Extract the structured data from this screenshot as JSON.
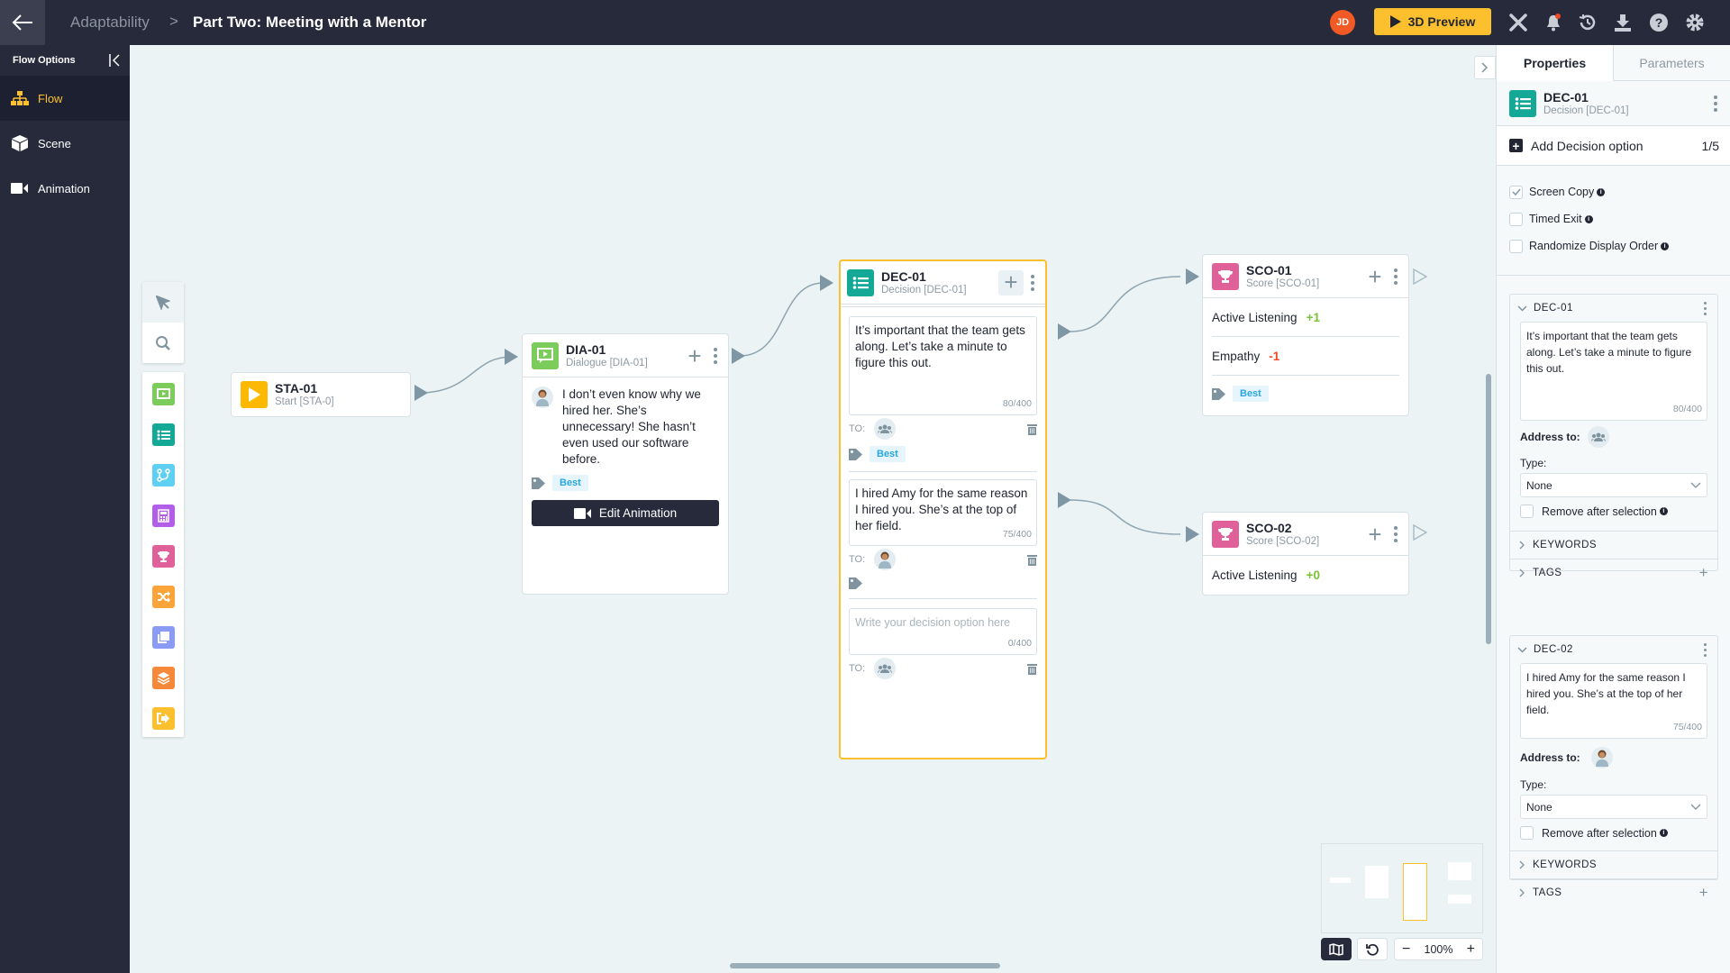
{
  "header": {
    "breadcrumb_parent": "Adaptability",
    "breadcrumb_separator": ">",
    "title": "Part Two: Meeting with a Mentor",
    "user_initials": "JD",
    "preview_label": "3D Preview",
    "icons": [
      "back-arrow-icon",
      "tools-icon",
      "bell-icon",
      "history-icon",
      "download-icon",
      "help-icon",
      "gear-icon"
    ]
  },
  "sidebar": {
    "title": "Flow Options",
    "items": [
      {
        "label": "Flow",
        "icon": "sitemap-icon",
        "active": true
      },
      {
        "label": "Scene",
        "icon": "cube-icon",
        "active": false
      },
      {
        "label": "Animation",
        "icon": "video-camera-icon",
        "active": false
      }
    ]
  },
  "toolbox": {
    "tools": [
      "pointer-icon",
      "search-icon"
    ],
    "node_types": [
      {
        "name": "dialogue",
        "color": "#7ccc5b"
      },
      {
        "name": "decision",
        "color": "#14a896"
      },
      {
        "name": "branch",
        "color": "#5fd0f2"
      },
      {
        "name": "calculator",
        "color": "#b15fe8"
      },
      {
        "name": "score",
        "color": "#e0609a"
      },
      {
        "name": "random",
        "color": "#fba43a"
      },
      {
        "name": "copy",
        "color": "#8a9bf5"
      },
      {
        "name": "layers",
        "color": "#f6883a"
      },
      {
        "name": "exit",
        "color": "#fcc02e"
      }
    ]
  },
  "nodes": {
    "start": {
      "title": "STA-01",
      "subtitle": "Start [STA-0]"
    },
    "dialogue": {
      "title": "DIA-01",
      "subtitle": "Dialogue [DIA-01]",
      "text": "I don’t even know why we hired her. She’s unnecessary! She hasn’t even used our software before.",
      "tag": "Best",
      "button": "Edit Animation"
    },
    "decision": {
      "title": "DEC-01",
      "subtitle": "Decision [DEC-01]",
      "to_label": "TO:",
      "options": [
        {
          "text": "It’s important that the team gets along. Let’s take a minute to figure this out.",
          "count": "80/400",
          "tag": "Best",
          "to": "group"
        },
        {
          "text": "I hired Amy for the same reason I hired you. She’s at the top of her field.",
          "count": "75/400",
          "tag": "",
          "to": "person"
        },
        {
          "text": "",
          "placeholder": "Write your decision option here",
          "count": "0/400",
          "to": "group"
        }
      ]
    },
    "score1": {
      "title": "SCO-01",
      "subtitle": "Score [SCO-01]",
      "rows": [
        {
          "label": "Active Listening",
          "value": "+1",
          "sign": "pos"
        },
        {
          "label": "Empathy",
          "value": "-1",
          "sign": "neg"
        }
      ],
      "tag": "Best"
    },
    "score2": {
      "title": "SCO-02",
      "subtitle": "Score [SCO-02]",
      "rows": [
        {
          "label": "Active Listening",
          "value": "+0",
          "sign": "pos"
        }
      ]
    }
  },
  "map_controls": {
    "zoom": "100%",
    "minus": "−",
    "plus": "+"
  },
  "panel": {
    "tabs": [
      "Properties",
      "Parameters"
    ],
    "active_tab": "Properties",
    "node_title": "DEC-01",
    "node_subtitle": "Decision [DEC-01]",
    "add_option_label": "Add Decision option",
    "option_count": "1/5",
    "checkboxes": [
      {
        "label": "Screen Copy",
        "checked": true
      },
      {
        "label": "Timed Exit",
        "checked": false
      },
      {
        "label": "Randomize Display Order",
        "checked": false
      }
    ],
    "cards": [
      {
        "id": "DEC-01",
        "text": "It’s important that the team gets along. Let’s take a minute to figure this out.",
        "count": "80/400",
        "address_label": "Address to:",
        "type_label": "Type:",
        "type_value": "None",
        "remove_label": "Remove after selection",
        "keywords_label": "KEYWORDS",
        "tags_label": "TAGS"
      },
      {
        "id": "DEC-02",
        "text": "I hired Amy for the same reason I hired you. She’s at the top of her field.",
        "count": "75/400",
        "address_label": "Address to:",
        "type_label": "Type:",
        "type_value": "None",
        "remove_label": "Remove after selection",
        "keywords_label": "KEYWORDS",
        "tags_label": "TAGS"
      }
    ]
  }
}
